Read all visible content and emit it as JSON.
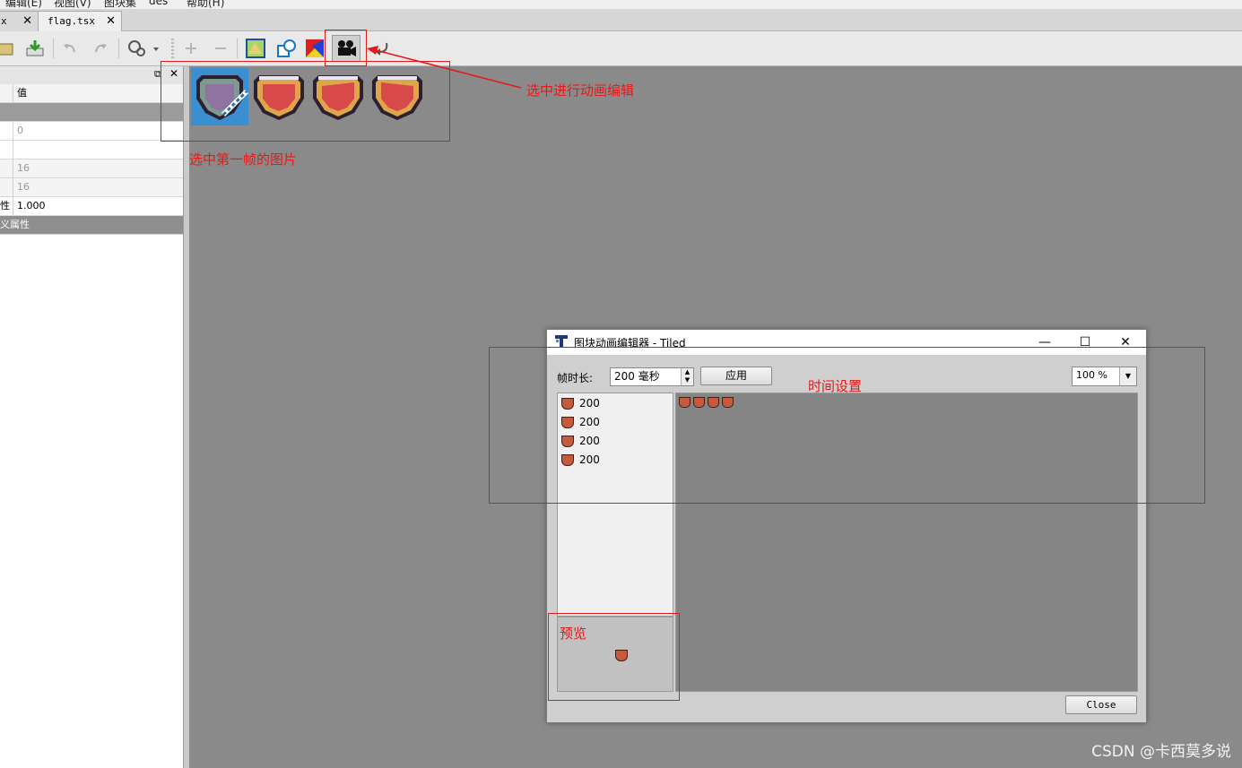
{
  "menubar": {
    "items": [
      "编辑(E)",
      "视图(V)",
      "图块集",
      "des",
      "帮助(H)"
    ]
  },
  "tabs": [
    {
      "label": "x",
      "close": "✕"
    },
    {
      "label": "flag.tsx",
      "close": "✕"
    }
  ],
  "properties": {
    "header_value": "值",
    "rows": [
      {
        "value": ""
      },
      {
        "value": "0"
      },
      {
        "value": ""
      },
      {
        "value": "16"
      },
      {
        "value": "16"
      },
      {
        "key": "性",
        "value": "1.000"
      }
    ],
    "custom_group": "义属性"
  },
  "annotations": {
    "animate_hint": "选中进行动画编辑",
    "first_frame_hint": "选中第一帧的图片",
    "time_hint": "时间设置",
    "preview_hint": "预览"
  },
  "dialog": {
    "title": "图块动画编辑器 - Tiled",
    "frame_duration_label": "帧时长:",
    "frame_duration_value": "200 毫秒",
    "apply_label": "应用",
    "zoom_value": "100 %",
    "frames": [
      "200",
      "200",
      "200",
      "200"
    ],
    "close_label": "Close"
  },
  "watermark": "CSDN @卡西莫多说",
  "colors": {
    "accent_red": "#e31a1a",
    "selection_blue": "#3a8fd0"
  }
}
